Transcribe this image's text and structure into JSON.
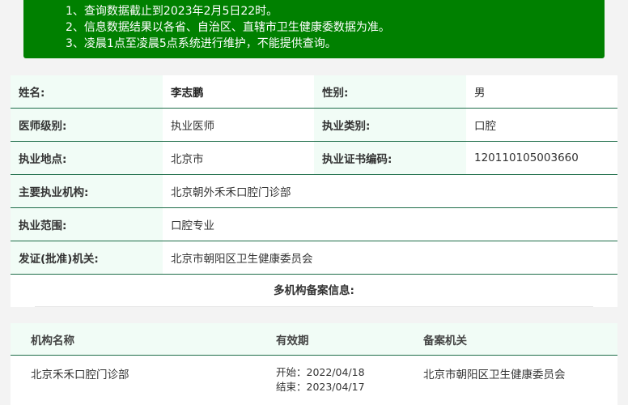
{
  "notice": {
    "lines": [
      "1、查询数据截止到2023年2月5日22时。",
      "2、信息数据结果以各省、自治区、直辖市卫生健康委数据为准。",
      "3、凌晨1点至凌晨5点系统进行维护，不能提供查询。"
    ]
  },
  "info": {
    "name_label": "姓名:",
    "name_value": "李志鹏",
    "gender_label": "性别:",
    "gender_value": "男",
    "level_label": "医师级别:",
    "level_value": "执业医师",
    "category_label": "执业类别:",
    "category_value": "口腔",
    "location_label": "执业地点:",
    "location_value": "北京市",
    "cert_label": "执业证书编码:",
    "cert_value": "120110105003660",
    "org_label": "主要执业机构:",
    "org_value": "北京朝外禾禾口腔门诊部",
    "scope_label": "执业范围:",
    "scope_value": "口腔专业",
    "authority_label": "发证(批准)机关:",
    "authority_value": "北京市朝阳区卫生健康委员会"
  },
  "multi": {
    "title": "多机构备案信息:",
    "headers": [
      "机构名称",
      "有效期",
      "备案机关"
    ],
    "rows": [
      {
        "org": "北京禾禾口腔门诊部",
        "start": "开始：2022/04/18",
        "end": "结束：2023/04/17",
        "authority": "北京市朝阳区卫生健康委员会"
      }
    ]
  },
  "colors": {
    "notice_bg": "#008000",
    "label_bg": "#f1fcf6",
    "row_border": "#1f6e4a"
  }
}
